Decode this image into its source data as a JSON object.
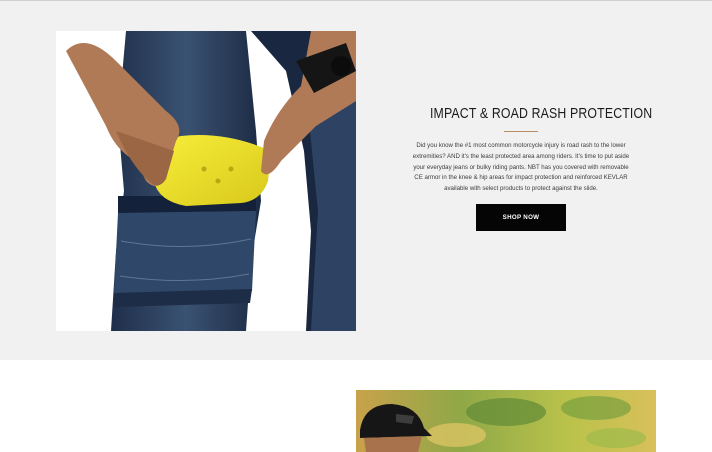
{
  "feature": {
    "image_alt": "Hands inserting a yellow CE knee armor pad into a pocket of dark blue riding jeans",
    "title": "IMPACT & ROAD RASH PROTECTION",
    "body": "Did you know the #1 most common motorcycle injury is road rash to the lower extremities? AND it's the least protected area among riders. It's time to put aside your everyday jeans or bulky riding pants. NBT has you covered with removable CE armor in the knee & hip areas for impact protection and reinforced KEVLAR available with select products to protect against the slide.",
    "cta_label": "SHOP NOW"
  },
  "next_section": {
    "image_alt": "Rider wearing a black trucker cap outdoors with blurred green and yellow foliage"
  },
  "colors": {
    "section_background": "#f2f1f1",
    "divider_accent": "#b98c62",
    "button_background": "#050505",
    "armor_yellow": "#f2e62a",
    "denim": "#2b3f5e"
  }
}
